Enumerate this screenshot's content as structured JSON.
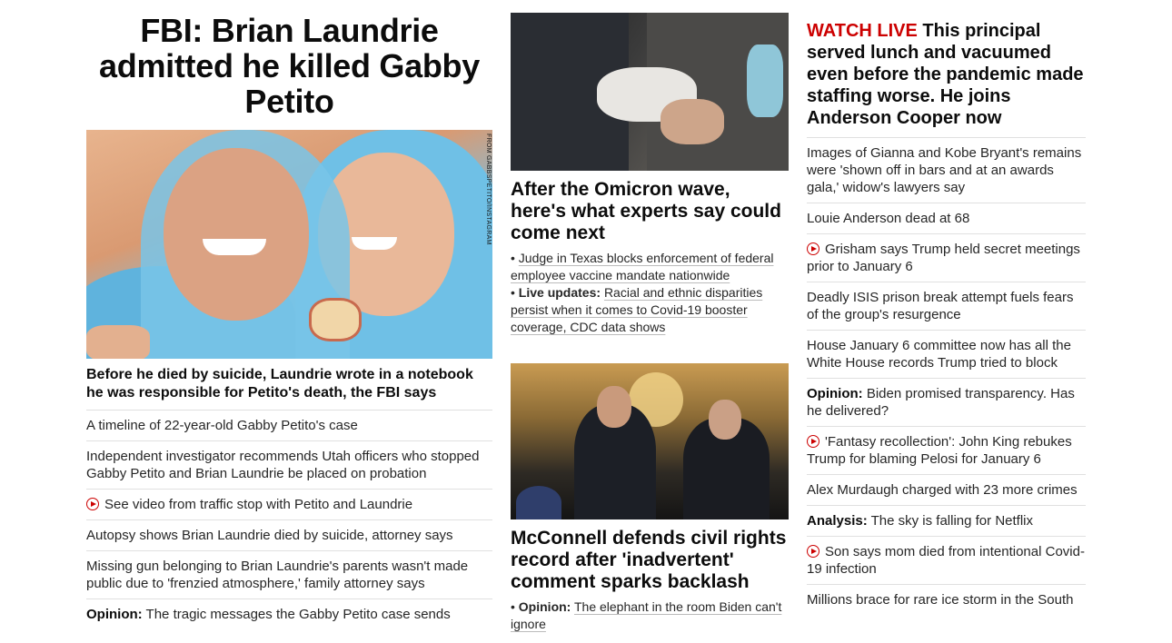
{
  "col1": {
    "headline": "FBI: Brian Laundrie admitted he killed Gabby Petito",
    "image_credit": "FROM GABBSPETITO/INSTAGRAM",
    "lead_sub": "Before he died by suicide, Laundrie wrote in a notebook he was responsible for Petito's death, the FBI says",
    "items": [
      {
        "text": "A timeline of 22-year-old Gabby Petito's case"
      },
      {
        "text": "Independent investigator recommends Utah officers who stopped Gabby Petito and Brian Laundrie be placed on probation"
      },
      {
        "text": "See video from traffic stop with Petito and Laundrie",
        "icon": "play-icon"
      },
      {
        "text": "Autopsy shows Brian Laundrie died by suicide, attorney says"
      },
      {
        "text": "Missing gun belonging to Brian Laundrie's parents wasn't made public due to 'frenzied atmosphere,' family attorney says"
      },
      {
        "prefix": "Opinion:",
        "text": " The tragic messages the Gabby Petito case sends"
      }
    ]
  },
  "col2": {
    "story1": {
      "headline": "After the Omicron wave, here's what experts say could come next",
      "bullet1": "Judge in Texas blocks enforcement of federal employee vaccine mandate nationwide",
      "bullet2_prefix": "Live updates:",
      "bullet2": "Racial and ethnic disparities persist when it comes to Covid-19 booster coverage, CDC data shows"
    },
    "story2": {
      "headline": "McConnell defends civil rights record after 'inadvertent' comment sparks backlash",
      "bullet1_prefix": "Opinion:",
      "bullet1": "The elephant in the room Biden can't ignore"
    }
  },
  "col3": {
    "live_label": "WATCH LIVE",
    "headline": "This principal served lunch and vacuumed even before the pandemic made staffing worse. He joins Anderson Cooper now",
    "items": [
      {
        "text": "Images of Gianna and Kobe Bryant's remains were 'shown off in bars and at an awards gala,' widow's lawyers say"
      },
      {
        "text": "Louie Anderson dead at 68"
      },
      {
        "text": "Grisham says Trump held secret meetings prior to January 6",
        "icon": "play-icon"
      },
      {
        "text": "Deadly ISIS prison break attempt fuels fears of the group's resurgence"
      },
      {
        "text": "House January 6 committee now has all the White House records Trump tried to block"
      },
      {
        "prefix": "Opinion:",
        "text": " Biden promised transparency. Has he delivered?"
      },
      {
        "text": "'Fantasy recollection': John King rebukes Trump for blaming Pelosi for January 6",
        "icon": "play-icon"
      },
      {
        "text": "Alex Murdaugh charged with 23 more crimes"
      },
      {
        "prefix": "Analysis:",
        "text": " The sky is falling for Netflix"
      },
      {
        "text": "Son says mom died from intentional Covid-19 infection",
        "icon": "play-icon"
      },
      {
        "text": "Millions brace for rare ice storm in the South"
      }
    ]
  },
  "colors": {
    "accent": "#cc0000",
    "divider": "#e0e0e0"
  }
}
